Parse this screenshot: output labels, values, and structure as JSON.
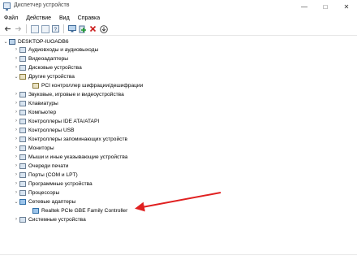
{
  "window": {
    "title": "Диспетчер устройств",
    "controls": [
      "—",
      "□",
      "✕"
    ]
  },
  "menu": [
    "Файл",
    "Действие",
    "Вид",
    "Справка"
  ],
  "toolbar": {
    "icons": [
      "back-arrow-icon",
      "forward-arrow-icon",
      "properties-icon",
      "refresh-icon",
      "help-icon",
      "monitor-icon",
      "add-driver-icon",
      "remove-device-icon",
      "download-icon"
    ]
  },
  "tree": {
    "root": "DESKTOP-IUOADB6",
    "items": [
      {
        "label": "Аудиовходы и аудиовыходы",
        "chevron": "›"
      },
      {
        "label": "Видеоадаптеры",
        "chevron": "›"
      },
      {
        "label": "Дисковые устройства",
        "chevron": "›"
      },
      {
        "label": "Другие устройства",
        "chevron": "⌄"
      },
      {
        "label": "PCI контроллер шифрации/дешифрации",
        "chevron": ""
      },
      {
        "label": "Звуковые, игровые и видеоустройства",
        "chevron": "›"
      },
      {
        "label": "Клавиатуры",
        "chevron": "›"
      },
      {
        "label": "Компьютер",
        "chevron": "›"
      },
      {
        "label": "Контроллеры IDE ATA/ATAPI",
        "chevron": "›"
      },
      {
        "label": "Контроллеры USB",
        "chevron": "›"
      },
      {
        "label": "Контроллеры запоминающих устройств",
        "chevron": "›"
      },
      {
        "label": "Мониторы",
        "chevron": "›"
      },
      {
        "label": "Мыши и иные указывающие устройства",
        "chevron": "›"
      },
      {
        "label": "Очереди печати",
        "chevron": "›"
      },
      {
        "label": "Порты (COM и LPT)",
        "chevron": "›"
      },
      {
        "label": "Программные устройства",
        "chevron": "›"
      },
      {
        "label": "Процессоры",
        "chevron": "›"
      },
      {
        "label": "Сетевые адаптеры",
        "chevron": "⌄"
      },
      {
        "label": "Realtek PCIe GBE Family Controller",
        "chevron": ""
      },
      {
        "label": "Системные устройства",
        "chevron": "›"
      }
    ]
  },
  "annotation": {
    "color": "#e02020"
  }
}
